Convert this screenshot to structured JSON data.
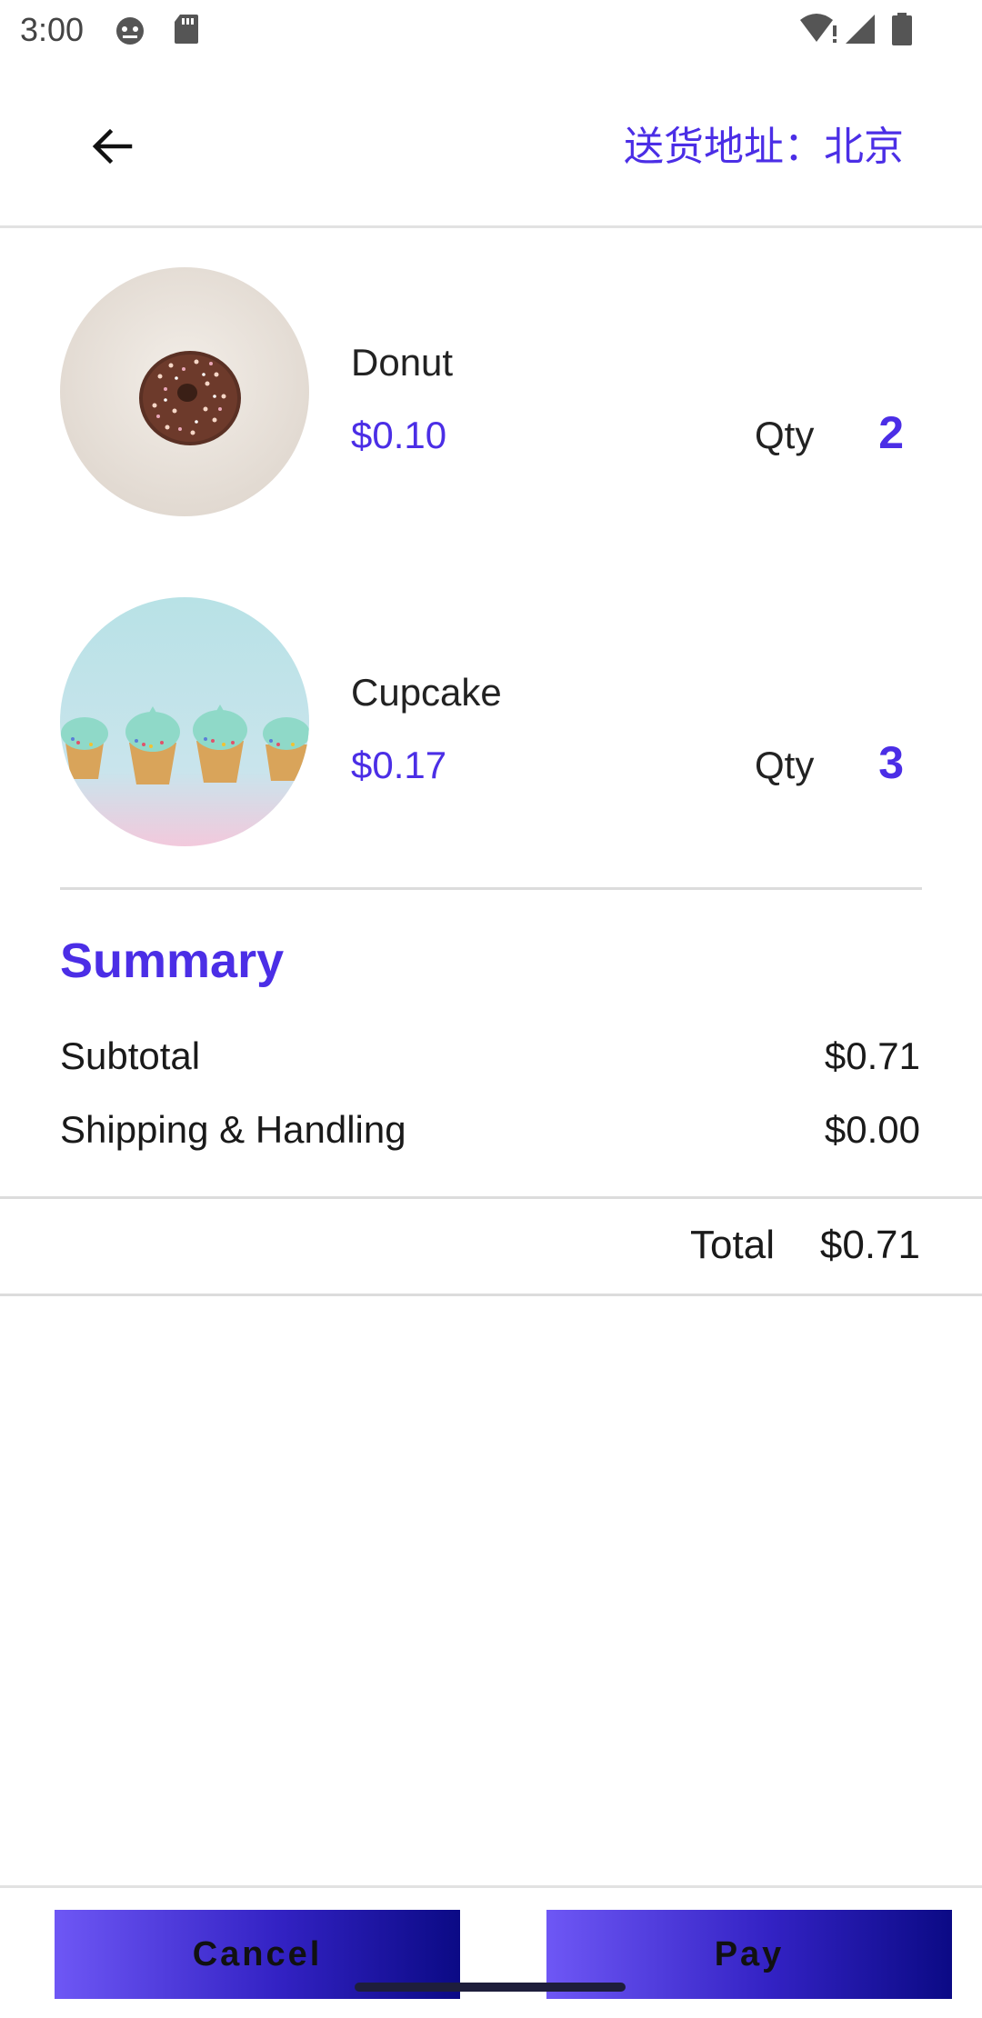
{
  "status_bar": {
    "time": "3:00",
    "icons": [
      "android-debug-icon",
      "sd-card-icon",
      "wifi-alert-icon",
      "signal-icon",
      "battery-icon"
    ]
  },
  "app_bar": {
    "back_icon": "arrow-left-icon",
    "address": "送货地址：北京"
  },
  "items": [
    {
      "name": "Donut",
      "price": "$0.10",
      "qty_label": "Qty",
      "qty": "2",
      "thumb": "donut-photo"
    },
    {
      "name": "Cupcake",
      "price": "$0.17",
      "qty_label": "Qty",
      "qty": "3",
      "thumb": "cupcake-photo"
    }
  ],
  "summary": {
    "title": "Summary",
    "rows": [
      {
        "label": "Subtotal",
        "value": "$0.71"
      },
      {
        "label": "Shipping & Handling",
        "value": "$0.00"
      }
    ],
    "total_label": "Total",
    "total_value": "$0.71"
  },
  "buttons": {
    "cancel": "Cancel",
    "pay": "Pay"
  },
  "colors": {
    "accent": "#4b2ee6",
    "button_gradient_start": "#6e57f5",
    "button_gradient_end": "#0b0a85"
  }
}
